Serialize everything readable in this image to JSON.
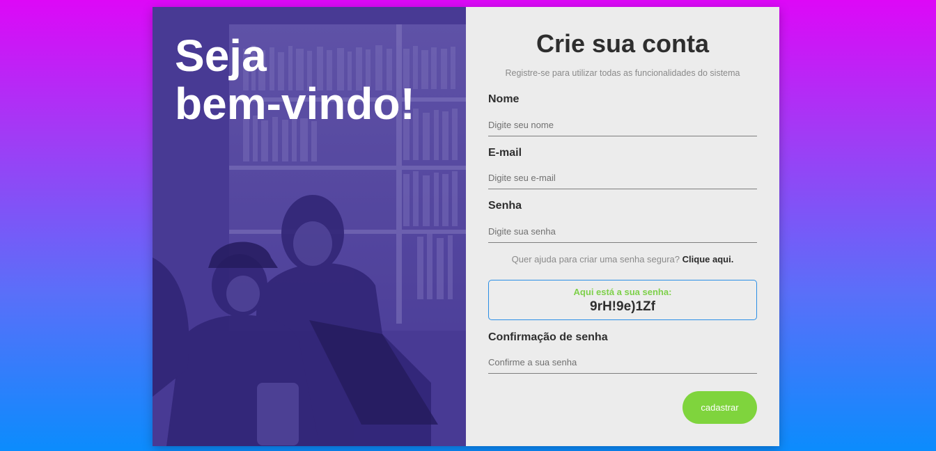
{
  "hero": {
    "line1": "Seja",
    "line2": "bem-vindo!"
  },
  "form": {
    "title": "Crie sua conta",
    "subtitle": "Registre-se para utilizar todas as funcionalidades do sistema",
    "name": {
      "label": "Nome",
      "placeholder": "Digite seu nome"
    },
    "email": {
      "label": "E-mail",
      "placeholder": "Digite seu e-mail"
    },
    "password": {
      "label": "Senha",
      "placeholder": "Digite sua senha"
    },
    "help_text": "Quer ajuda para criar uma senha segura?",
    "help_link": "Clique aqui.",
    "generated": {
      "label": "Aqui está a sua senha:",
      "value": "9rH!9e)1Zf"
    },
    "confirm": {
      "label": "Confirmação de senha",
      "placeholder": "Confirme a sua senha"
    },
    "submit_label": "cadastrar"
  },
  "colors": {
    "overlay": "#4a3c95",
    "accent_green": "#7fd43d",
    "box_border": "#2a8ee5",
    "panel_bg": "#ececec"
  }
}
